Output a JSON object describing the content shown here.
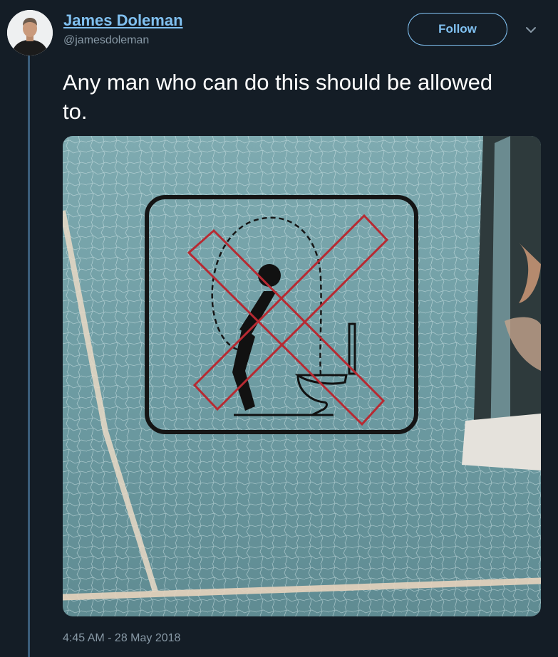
{
  "tweet": {
    "author": {
      "display_name": "James Doleman",
      "handle": "@jamesdoleman",
      "avatar_icon": "profile-photo"
    },
    "follow_label": "Follow",
    "menu_icon": "chevron-down-icon",
    "text": "Any man who can do this should be allowed to.",
    "timestamp": "4:45 AM - 28 May 2018"
  },
  "colors": {
    "background": "#141d26",
    "accent": "#80c0f0",
    "secondary_text": "#8899a6",
    "thread_line": "#3b5d7a"
  },
  "media": {
    "description_icon": "no-peeing-while-standing-sign"
  }
}
